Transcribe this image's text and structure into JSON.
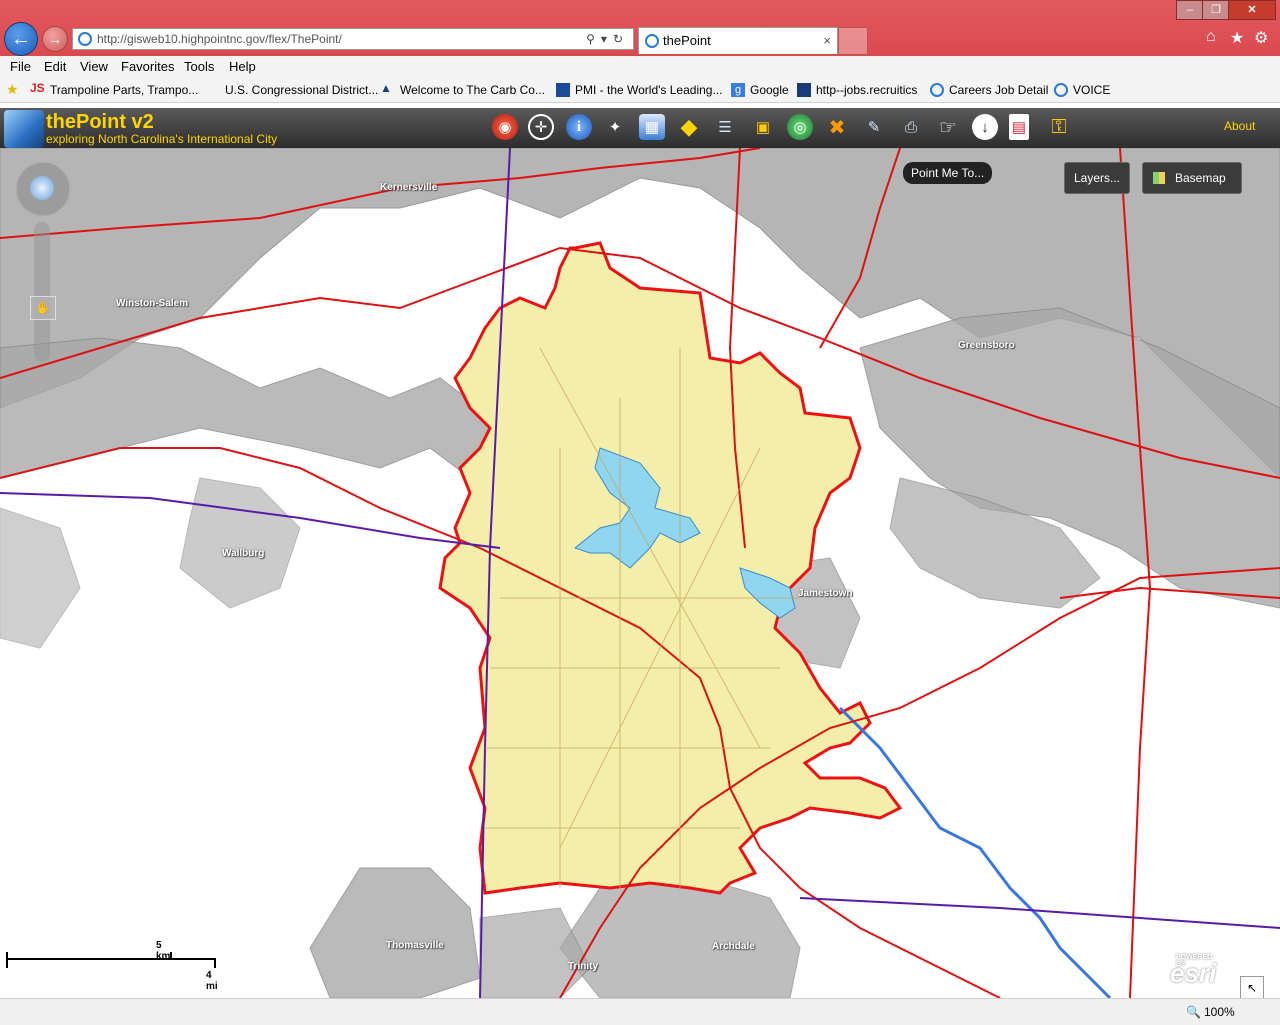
{
  "browser": {
    "address_url": "http://gisweb10.highpointnc.gov/flex/ThePoint/",
    "tab_title": "thePoint",
    "menu": [
      "File",
      "Edit",
      "View",
      "Favorites",
      "Tools",
      "Help"
    ],
    "favorites": [
      "Trampoline Parts, Trampo...",
      "U.S. Congressional District...",
      "Welcome to The Carb Co...",
      "PMI - the World's Leading...",
      "Google",
      "http--jobs.recruitics",
      "Careers  Job Detail",
      "VOICE"
    ],
    "zoom": "100%"
  },
  "app": {
    "title": "thePoint v2",
    "subtitle": "exploring North Carolina's International City",
    "about_label": "About",
    "tooltip": "Point Me To...",
    "layers_label": "Layers...",
    "basemap_label": "Basemap",
    "toolbar_icons": [
      "target-icon",
      "crosshair-icon",
      "info-icon",
      "magic-icon",
      "table-icon",
      "navigate-icon",
      "layers-icon",
      "lock-icon",
      "globe-icon",
      "measure-icon",
      "tool-icon",
      "print-icon",
      "pointing-hand-icon",
      "download-icon",
      "document-icon",
      "key-icon"
    ]
  },
  "map": {
    "cities": [
      "Kernersville",
      "Winston-Salem",
      "Greensboro",
      "Wallburg",
      "Jamestown",
      "Thomasville",
      "Archdale",
      "Trinity"
    ],
    "scale_km": "5 km",
    "scale_mi": "4 mi",
    "attribution": "esri",
    "attribution_small": "POWERED BY"
  }
}
